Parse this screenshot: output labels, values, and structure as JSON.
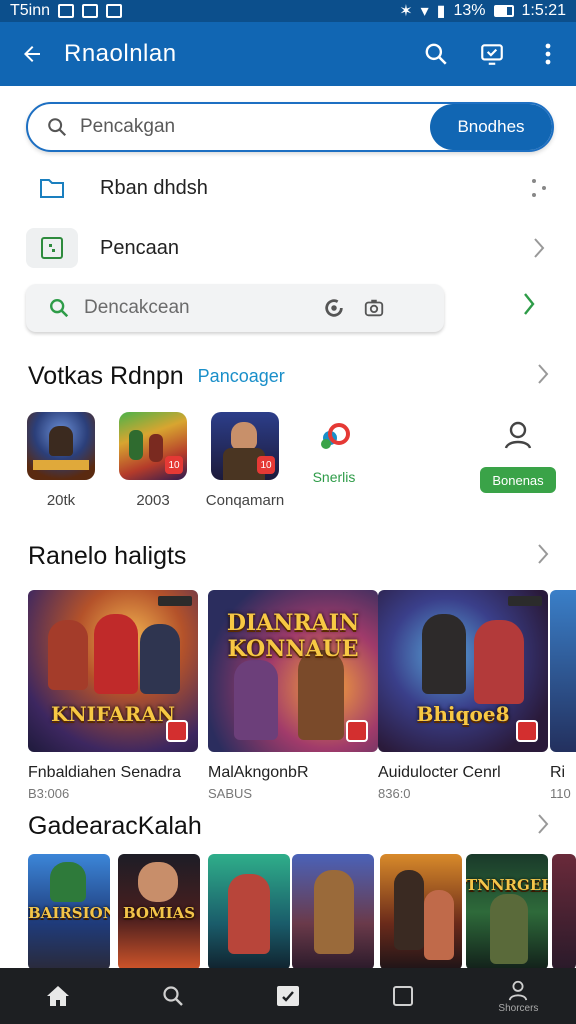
{
  "status_bar": {
    "left_text": "T5inn",
    "battery": "13%",
    "time": "1:5:21"
  },
  "app_bar": {
    "title": "Rnaolnlan",
    "icons": [
      "back-arrow-icon",
      "search-icon",
      "cast-icon",
      "more-vert-icon"
    ]
  },
  "search": {
    "placeholder": "Pencakgan",
    "button_label": "Bnodhes"
  },
  "menu": {
    "row1_label": "Rban dhdsh",
    "row2_label": "Pencaan"
  },
  "second_search": {
    "placeholder": "Dencakcean"
  },
  "section_recent": {
    "title": "Votkas Rdnpn",
    "subtitle": "Pancoager",
    "apps": [
      {
        "caption": "20tk"
      },
      {
        "caption": "2003"
      },
      {
        "caption": "Conqamarn"
      }
    ],
    "shorts_label": "Snerlis",
    "pill_label": "Bonenas"
  },
  "section_featured": {
    "title": "Ranelo haligts",
    "cards": [
      {
        "art_text": "KNIFARAN",
        "title": "Fnbaldiahen Senadra",
        "meta": "B3:006"
      },
      {
        "art_text": "DIANRAIN KONNAUE",
        "title": "MalAkngonbR",
        "meta": "SABUS"
      },
      {
        "art_text": "Bhiqoe8",
        "title": "Auidulocter Cenrl",
        "meta": "836:0"
      },
      {
        "art_text": "",
        "title": "Ri",
        "meta": "110"
      }
    ]
  },
  "section_grid": {
    "title": "GadearacKalah",
    "cards": [
      {
        "art_text": "BAIRSION"
      },
      {
        "art_text": "BOMIAS"
      },
      {
        "art_text": ""
      },
      {
        "art_text": ""
      },
      {
        "art_text": ""
      },
      {
        "art_text": "TNNRGEHI"
      },
      {
        "art_text": ""
      }
    ]
  },
  "nav": {
    "items": [
      "home-icon",
      "search-icon",
      "library-icon",
      "tablet-icon",
      "profile-icon"
    ],
    "profile_label": "Shorcers"
  },
  "colors": {
    "app_bar": "#1166b3",
    "status_bar": "#0c4f8c",
    "accent_green": "#3aa348",
    "link_blue": "#1a8fc9"
  }
}
